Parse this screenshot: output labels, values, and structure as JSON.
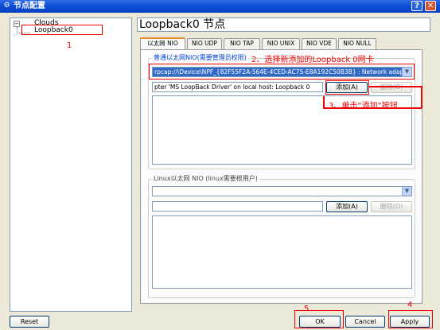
{
  "window": {
    "title": "节点配置",
    "help_label": "?",
    "close_label": "✕",
    "app_icon": "gear-icon"
  },
  "tree": {
    "expander": "−",
    "root": "Clouds",
    "child": "Loopback0"
  },
  "panel": {
    "title": "Loopback0 节点"
  },
  "tabs": [
    "以太网 NIO",
    "NIO UDP",
    "NIO TAP",
    "NIO UNIX",
    "NIO VDE",
    "NIO NULL"
  ],
  "generic_eth": {
    "label": "普通以太网NIO(需要管理员权限)",
    "selected_adapter": "rpcap://\\Device\\NPF_{82F55F2A-564E-4CED-AC75-E8A192C50B3B} : Network adapter 'MS LoopBack Driver' on local host: Loopback 0",
    "input_value": "pter 'MS LoopBack Driver' on local host: Loopback 0",
    "add_label": "添加(A)",
    "delete_label": "删除(D)"
  },
  "linux_eth": {
    "label": "Linux以太网 NIO (linux需要根用户)",
    "input_value": "",
    "add_label": "添加(A)",
    "delete_label": "删除(D)"
  },
  "buttons": {
    "reset": "Reset",
    "ok": "OK",
    "cancel": "Cancel",
    "apply": "Apply"
  },
  "annotations": {
    "a1": "1",
    "a2": "2、选择新添加的Loopback 0网卡",
    "a3": "3、单击“添加”按钮",
    "a4": "4",
    "a5": "5"
  },
  "colors": {
    "annotation": "#e00000",
    "titlebar": "#0a4bd1",
    "selection": "#316ac5"
  }
}
